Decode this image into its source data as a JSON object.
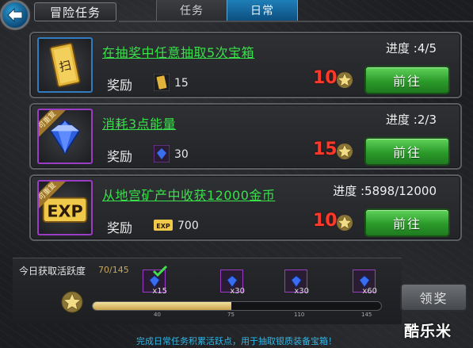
{
  "header": {
    "title": "冒险任务",
    "tabs": [
      {
        "label": "任务",
        "active": false
      },
      {
        "label": "日常",
        "active": true
      }
    ]
  },
  "tasks": [
    {
      "name": "在抽奖中任意抽取5次宝箱",
      "progress": "进度 :4/5",
      "reward_label": "奖励",
      "reward_icon": "ticket-icon",
      "reward_amount": "15",
      "points": "10",
      "button": "前往",
      "repeatable": false
    },
    {
      "name": "消耗3点能量",
      "progress": "进度 :2/3",
      "reward_label": "奖励",
      "reward_icon": "diamond-icon",
      "reward_amount": "30",
      "points": "15",
      "button": "前往",
      "repeatable": true,
      "repeat_tag": "可重复"
    },
    {
      "name": "从地宫矿产中收获12000金币",
      "progress": "进度 :5898/12000",
      "reward_label": "奖励",
      "reward_icon": "exp-icon",
      "reward_amount": "700",
      "points": "10",
      "button": "前往",
      "repeatable": true,
      "repeat_tag": "可重复"
    }
  ],
  "activity": {
    "label": "今日获取活跃度",
    "value": "70/145",
    "fill_fraction": 0.48,
    "milestones": [
      {
        "threshold": "40",
        "reward": "x15",
        "claimed": true
      },
      {
        "threshold": "75",
        "reward": "x30",
        "claimed": false
      },
      {
        "threshold": "110",
        "reward": "x30",
        "claimed": false
      },
      {
        "threshold": "145",
        "reward": "x60",
        "claimed": false
      }
    ],
    "claim_button": "领奖"
  },
  "footer": "完成日常任务积累活跃点，用于抽取银质装备宝箱！",
  "watermark": "酷乐米",
  "colors": {
    "task_name": "#39e04a",
    "points": "#ff3a2a",
    "go_button": "#2b9a2a",
    "active_tab": "#1f7fb8",
    "footer": "#2fb7e8"
  }
}
